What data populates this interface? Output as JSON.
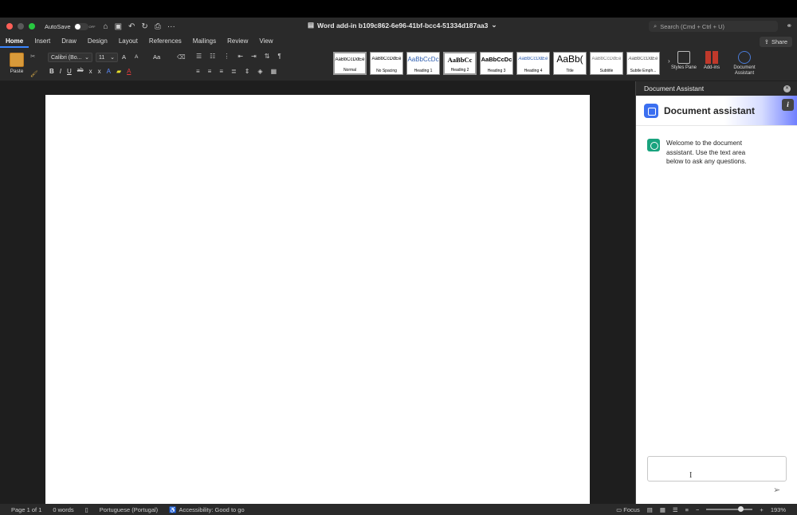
{
  "window": {
    "autosave_label": "AutoSave",
    "autosave_state": "OFF",
    "document_title": "Word add-in b109c862-6e96-41bf-bcc4-51334d187aa3",
    "search_placeholder": "Search (Cmd + Ctrl + U)"
  },
  "tabs": [
    "Home",
    "Insert",
    "Draw",
    "Design",
    "Layout",
    "References",
    "Mailings",
    "Review",
    "View"
  ],
  "share_label": "Share",
  "ribbon": {
    "paste_label": "Paste",
    "font_name": "Calibri (Bo...",
    "font_size": "11",
    "grow_font": "A",
    "shrink_font": "A",
    "change_case": "Aa",
    "bold": "B",
    "italic": "I",
    "underline": "U",
    "strike": "ab",
    "subscript": "x",
    "superscript": "x",
    "styles": [
      {
        "sample": "AaBbCcDdEe",
        "name": "Normal"
      },
      {
        "sample": "AaBbCcDdEe",
        "name": "No Spacing"
      },
      {
        "sample": "AaBbCcDc",
        "name": "Heading 1"
      },
      {
        "sample": "AaBbCc",
        "name": "Heading 2"
      },
      {
        "sample": "AaBbCcDc",
        "name": "Heading 3"
      },
      {
        "sample": "AaBbCcDdEe",
        "name": "Heading 4"
      },
      {
        "sample": "AaBb(",
        "name": "Title"
      },
      {
        "sample": "AaBbCcDdEe",
        "name": "Subtitle"
      },
      {
        "sample": "AaBbCcDdEe",
        "name": "Subtle Emph..."
      }
    ],
    "styles_pane_label": "Styles Pane",
    "addins_label": "Add-ins",
    "doc_assistant_label": "Document Assistant"
  },
  "pane": {
    "header": "Document Assistant",
    "title": "Document assistant",
    "welcome": "Welcome to the document assistant. Use the text area below to ask any questions."
  },
  "status": {
    "page": "Page 1 of 1",
    "words": "0 words",
    "language": "Portuguese (Portugal)",
    "accessibility": "Accessibility: Good to go",
    "focus": "Focus",
    "zoom": "193%"
  },
  "colors": {
    "accent_blue": "#3a86ff",
    "assistant_logo": "#3b6ff0",
    "chat_avatar": "#19a37e",
    "close_red": "#ff5f57"
  }
}
